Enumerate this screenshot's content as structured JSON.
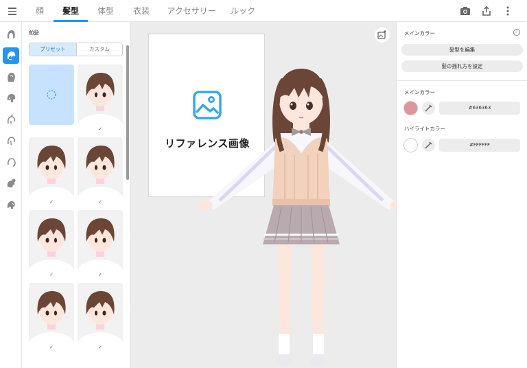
{
  "tabs": [
    {
      "label": "顔",
      "active": false
    },
    {
      "label": "髪型",
      "active": true
    },
    {
      "label": "体型",
      "active": false
    },
    {
      "label": "衣装",
      "active": false
    },
    {
      "label": "アクセサリー",
      "active": false
    },
    {
      "label": "ルック",
      "active": false
    }
  ],
  "top_icons": [
    "camera-icon",
    "share-icon",
    "more-vertical-icon"
  ],
  "rail_icons": [
    "hair-base-icon",
    "front-hair-icon",
    "back-hair-icon",
    "side-hair-icon",
    "ahoge-icon",
    "ear-hair-icon",
    "ponytail-icon",
    "bun-icon",
    "extra-hair-icon"
  ],
  "panel": {
    "title": "前髪",
    "segment": {
      "preset": "プリセット",
      "custom": "カスタム"
    },
    "presets": [
      {
        "name": "none",
        "selected": true,
        "checked": false
      },
      {
        "name": "bangs-1",
        "selected": false,
        "checked": true
      },
      {
        "name": "bangs-2",
        "selected": false,
        "checked": true
      },
      {
        "name": "bangs-3",
        "selected": false,
        "checked": true
      },
      {
        "name": "bangs-4",
        "selected": false,
        "checked": true
      },
      {
        "name": "bangs-5",
        "selected": false,
        "checked": true
      },
      {
        "name": "bangs-6",
        "selected": false,
        "checked": true
      },
      {
        "name": "bangs-7",
        "selected": false,
        "checked": true
      }
    ]
  },
  "viewport": {
    "reference_text": "リファレンス画像"
  },
  "right_panel": {
    "main_color_header": "メインカラー",
    "edit_hair_button": "髪型を編集",
    "sway_button": "髪の揺れ方を設定",
    "main_color_label": "メインカラー",
    "main_color_hex": "#636363",
    "main_swatch_color": "#e0959a",
    "highlight_label": "ハイライトカラー",
    "highlight_hex": "#FFFFFF",
    "highlight_swatch_color": "#ffffff"
  },
  "colors": {
    "accent": "#2196f3",
    "hair_brown": "#6b4636",
    "skin": "#fde6dc",
    "vest": "#f2d1bd",
    "skirt": "#b9aab0"
  }
}
